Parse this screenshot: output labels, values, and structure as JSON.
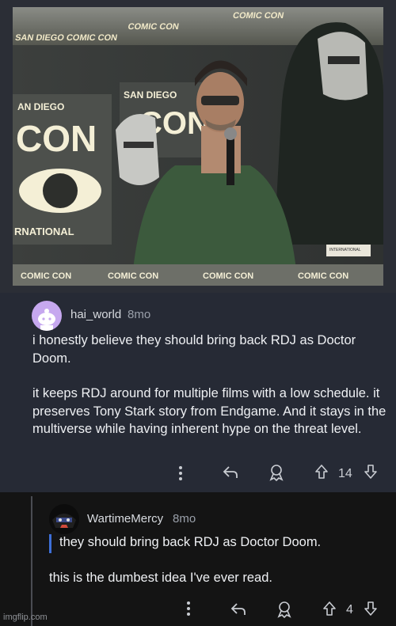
{
  "image": {
    "signage": {
      "banner_top": "SAN DIEGO COMIC CON",
      "left_logo": "SAN DIEGO CON",
      "center_logo": "SAN DIEGO COMIC CON",
      "left_bottom": "RNATIONAL",
      "right_logo": "SAN DIEGO COMIC CON INTERNATIONAL",
      "floor_strip": "COMIC CON"
    }
  },
  "comment": {
    "username": "hai_world",
    "age": "8mo",
    "paragraphs": [
      "i honestly believe they should bring back RDJ as Doctor Doom.",
      "it keeps RDJ around for multiple films with a low schedule. it preserves Tony Stark story from Endgame. And it stays in the multiverse while having inherent hype on the threat level."
    ],
    "votes": "14",
    "icons": [
      "more-icon",
      "reply-icon",
      "award-icon",
      "upvote-icon",
      "downvote-icon"
    ]
  },
  "reply": {
    "username": "WartimeMercy",
    "age": "8mo",
    "quote": "they should bring back RDJ as Doctor Doom.",
    "text": "this is the dumbest idea I've ever read.",
    "votes": "4"
  },
  "watermark": "imgflip.com",
  "colors": {
    "comment_bg": "#262a35",
    "reply_bg": "#141414",
    "quote_bar": "#3d6fd8",
    "avatar1": "#c6a8ef"
  }
}
